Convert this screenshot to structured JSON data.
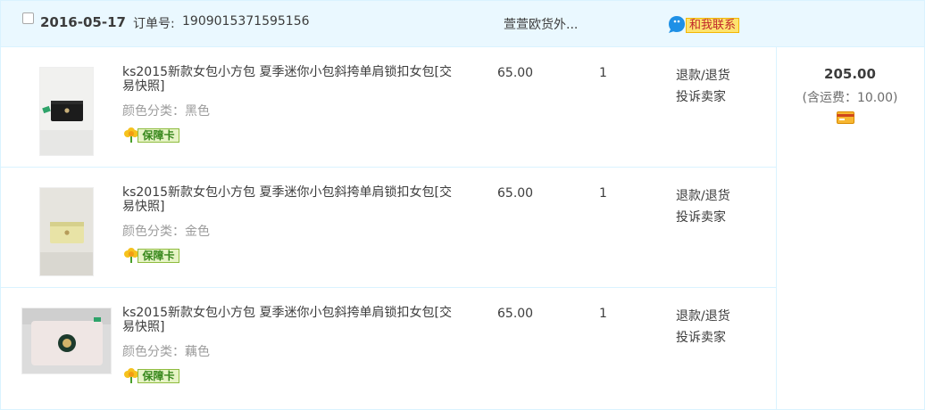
{
  "order": {
    "date": "2016-05-17",
    "order_no_label": "订单号:",
    "order_no": "1909015371595156",
    "shop_name": "萱萱欧货外...",
    "contact_label": "和我联系",
    "total": "205.00",
    "shipping_text": "(含运费：10.00)",
    "items": [
      {
        "title": "ks2015新款女包小方包 夏季迷你小包斜挎单肩锁扣女包[交易快照]",
        "sku": "颜色分类：黑色",
        "guarantee": "保障卡",
        "price": "65.00",
        "qty": "1",
        "op1": "退款/退货",
        "op2": "投诉卖家"
      },
      {
        "title": "ks2015新款女包小方包 夏季迷你小包斜挎单肩锁扣女包[交易快照]",
        "sku": "颜色分类：金色",
        "guarantee": "保障卡",
        "price": "65.00",
        "qty": "1",
        "op1": "退款/退货",
        "op2": "投诉卖家"
      },
      {
        "title": "ks2015新款女包小方包 夏季迷你小包斜挎单肩锁扣女包[交易快照]",
        "sku": "颜色分类：藕色",
        "guarantee": "保障卡",
        "price": "65.00",
        "qty": "1",
        "op1": "退款/退货",
        "op2": "投诉卖家"
      }
    ]
  },
  "colors": {
    "header_bg": "#eaf8ff",
    "border": "#daf3ff",
    "contact_bg": "#fde36f",
    "contact_text": "#c0252a",
    "guarantee_green": "#36871b"
  },
  "icons": {
    "checkbox": "checkbox-icon",
    "contact": "chat-bubble-icon",
    "guarantee": "flower-icon",
    "payment": "card-icon"
  }
}
